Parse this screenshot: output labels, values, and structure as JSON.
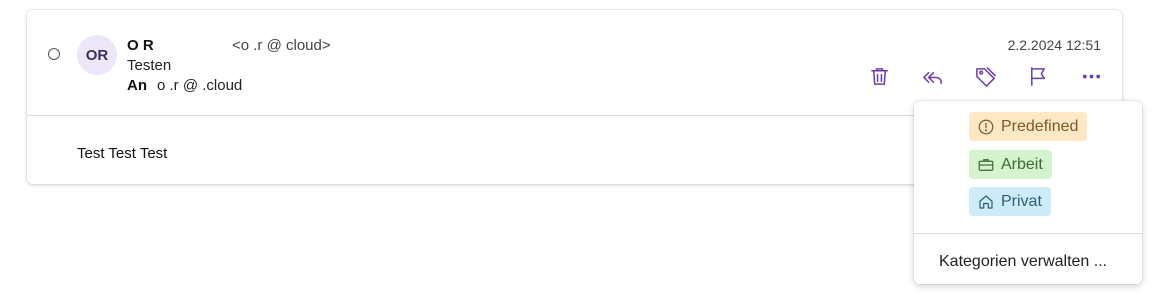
{
  "message": {
    "avatar_initials": "OR",
    "from_name": "O   R",
    "from_email": "<o   .r            @              cloud>",
    "subject": "Testen",
    "to_label": "An",
    "to_email": "o   .r            @                         .cloud",
    "date": "2.2.2024 12:51",
    "body": "Test Test Test"
  },
  "actions": [
    "trash-icon",
    "reply-all-icon",
    "tag-icon",
    "flag-icon",
    "more-icon"
  ],
  "category_menu": {
    "items": [
      {
        "label": "Predefined",
        "icon": "alert-circle-icon",
        "color": "#fde7c4"
      },
      {
        "label": "Arbeit",
        "icon": "briefcase-icon",
        "color": "#d5f3cd"
      },
      {
        "label": "Privat",
        "icon": "home-icon",
        "color": "#cdebf8"
      }
    ],
    "manage_label": "Kategorien verwalten ..."
  },
  "colors": {
    "accent": "#6b3fb0"
  }
}
